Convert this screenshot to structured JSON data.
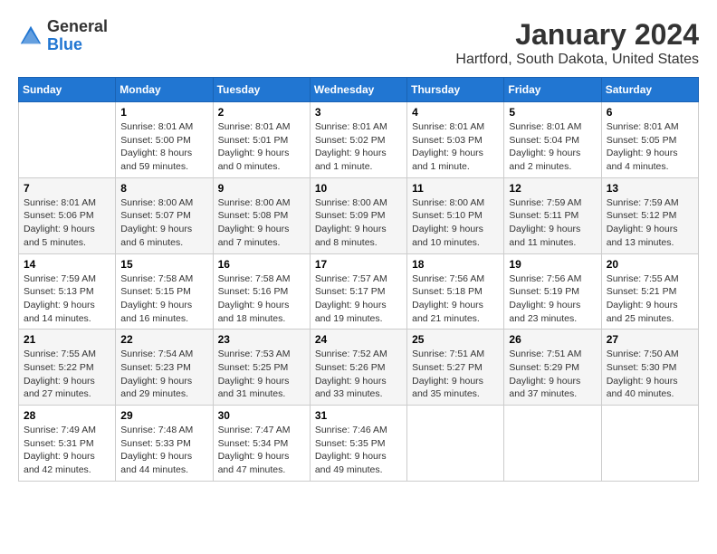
{
  "header": {
    "logo_general": "General",
    "logo_blue": "Blue",
    "month": "January 2024",
    "location": "Hartford, South Dakota, United States"
  },
  "weekdays": [
    "Sunday",
    "Monday",
    "Tuesday",
    "Wednesday",
    "Thursday",
    "Friday",
    "Saturday"
  ],
  "weeks": [
    [
      {
        "day": "",
        "info": ""
      },
      {
        "day": "1",
        "info": "Sunrise: 8:01 AM\nSunset: 5:00 PM\nDaylight: 8 hours\nand 59 minutes."
      },
      {
        "day": "2",
        "info": "Sunrise: 8:01 AM\nSunset: 5:01 PM\nDaylight: 9 hours\nand 0 minutes."
      },
      {
        "day": "3",
        "info": "Sunrise: 8:01 AM\nSunset: 5:02 PM\nDaylight: 9 hours\nand 1 minute."
      },
      {
        "day": "4",
        "info": "Sunrise: 8:01 AM\nSunset: 5:03 PM\nDaylight: 9 hours\nand 1 minute."
      },
      {
        "day": "5",
        "info": "Sunrise: 8:01 AM\nSunset: 5:04 PM\nDaylight: 9 hours\nand 2 minutes."
      },
      {
        "day": "6",
        "info": "Sunrise: 8:01 AM\nSunset: 5:05 PM\nDaylight: 9 hours\nand 4 minutes."
      }
    ],
    [
      {
        "day": "7",
        "info": "Sunrise: 8:01 AM\nSunset: 5:06 PM\nDaylight: 9 hours\nand 5 minutes."
      },
      {
        "day": "8",
        "info": "Sunrise: 8:00 AM\nSunset: 5:07 PM\nDaylight: 9 hours\nand 6 minutes."
      },
      {
        "day": "9",
        "info": "Sunrise: 8:00 AM\nSunset: 5:08 PM\nDaylight: 9 hours\nand 7 minutes."
      },
      {
        "day": "10",
        "info": "Sunrise: 8:00 AM\nSunset: 5:09 PM\nDaylight: 9 hours\nand 8 minutes."
      },
      {
        "day": "11",
        "info": "Sunrise: 8:00 AM\nSunset: 5:10 PM\nDaylight: 9 hours\nand 10 minutes."
      },
      {
        "day": "12",
        "info": "Sunrise: 7:59 AM\nSunset: 5:11 PM\nDaylight: 9 hours\nand 11 minutes."
      },
      {
        "day": "13",
        "info": "Sunrise: 7:59 AM\nSunset: 5:12 PM\nDaylight: 9 hours\nand 13 minutes."
      }
    ],
    [
      {
        "day": "14",
        "info": "Sunrise: 7:59 AM\nSunset: 5:13 PM\nDaylight: 9 hours\nand 14 minutes."
      },
      {
        "day": "15",
        "info": "Sunrise: 7:58 AM\nSunset: 5:15 PM\nDaylight: 9 hours\nand 16 minutes."
      },
      {
        "day": "16",
        "info": "Sunrise: 7:58 AM\nSunset: 5:16 PM\nDaylight: 9 hours\nand 18 minutes."
      },
      {
        "day": "17",
        "info": "Sunrise: 7:57 AM\nSunset: 5:17 PM\nDaylight: 9 hours\nand 19 minutes."
      },
      {
        "day": "18",
        "info": "Sunrise: 7:56 AM\nSunset: 5:18 PM\nDaylight: 9 hours\nand 21 minutes."
      },
      {
        "day": "19",
        "info": "Sunrise: 7:56 AM\nSunset: 5:19 PM\nDaylight: 9 hours\nand 23 minutes."
      },
      {
        "day": "20",
        "info": "Sunrise: 7:55 AM\nSunset: 5:21 PM\nDaylight: 9 hours\nand 25 minutes."
      }
    ],
    [
      {
        "day": "21",
        "info": "Sunrise: 7:55 AM\nSunset: 5:22 PM\nDaylight: 9 hours\nand 27 minutes."
      },
      {
        "day": "22",
        "info": "Sunrise: 7:54 AM\nSunset: 5:23 PM\nDaylight: 9 hours\nand 29 minutes."
      },
      {
        "day": "23",
        "info": "Sunrise: 7:53 AM\nSunset: 5:25 PM\nDaylight: 9 hours\nand 31 minutes."
      },
      {
        "day": "24",
        "info": "Sunrise: 7:52 AM\nSunset: 5:26 PM\nDaylight: 9 hours\nand 33 minutes."
      },
      {
        "day": "25",
        "info": "Sunrise: 7:51 AM\nSunset: 5:27 PM\nDaylight: 9 hours\nand 35 minutes."
      },
      {
        "day": "26",
        "info": "Sunrise: 7:51 AM\nSunset: 5:29 PM\nDaylight: 9 hours\nand 37 minutes."
      },
      {
        "day": "27",
        "info": "Sunrise: 7:50 AM\nSunset: 5:30 PM\nDaylight: 9 hours\nand 40 minutes."
      }
    ],
    [
      {
        "day": "28",
        "info": "Sunrise: 7:49 AM\nSunset: 5:31 PM\nDaylight: 9 hours\nand 42 minutes."
      },
      {
        "day": "29",
        "info": "Sunrise: 7:48 AM\nSunset: 5:33 PM\nDaylight: 9 hours\nand 44 minutes."
      },
      {
        "day": "30",
        "info": "Sunrise: 7:47 AM\nSunset: 5:34 PM\nDaylight: 9 hours\nand 47 minutes."
      },
      {
        "day": "31",
        "info": "Sunrise: 7:46 AM\nSunset: 5:35 PM\nDaylight: 9 hours\nand 49 minutes."
      },
      {
        "day": "",
        "info": ""
      },
      {
        "day": "",
        "info": ""
      },
      {
        "day": "",
        "info": ""
      }
    ]
  ]
}
